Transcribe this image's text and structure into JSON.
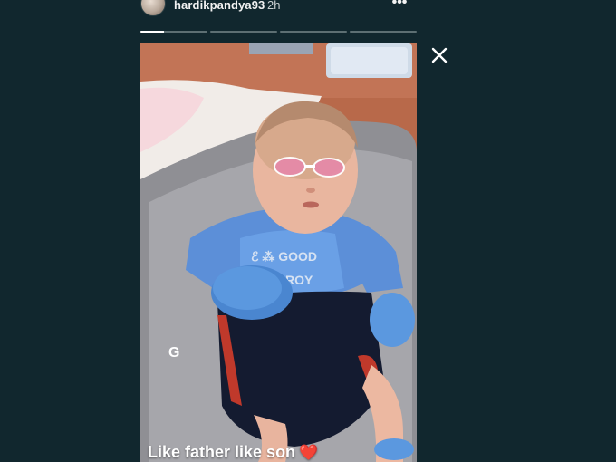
{
  "header": {
    "username": "hardikpandya93",
    "time_ago": "2h",
    "more_icon": "more-horizontal-icon"
  },
  "progress": {
    "segments": 4,
    "active_index": 0,
    "active_fraction": 0.35
  },
  "close_icon": "close-icon",
  "story": {
    "caption": "Like father like son",
    "heart_glyph": "❤️",
    "watermark": "G"
  },
  "colors": {
    "background": "#11272e",
    "text": "#ffffff",
    "heart": "#f0343f"
  }
}
